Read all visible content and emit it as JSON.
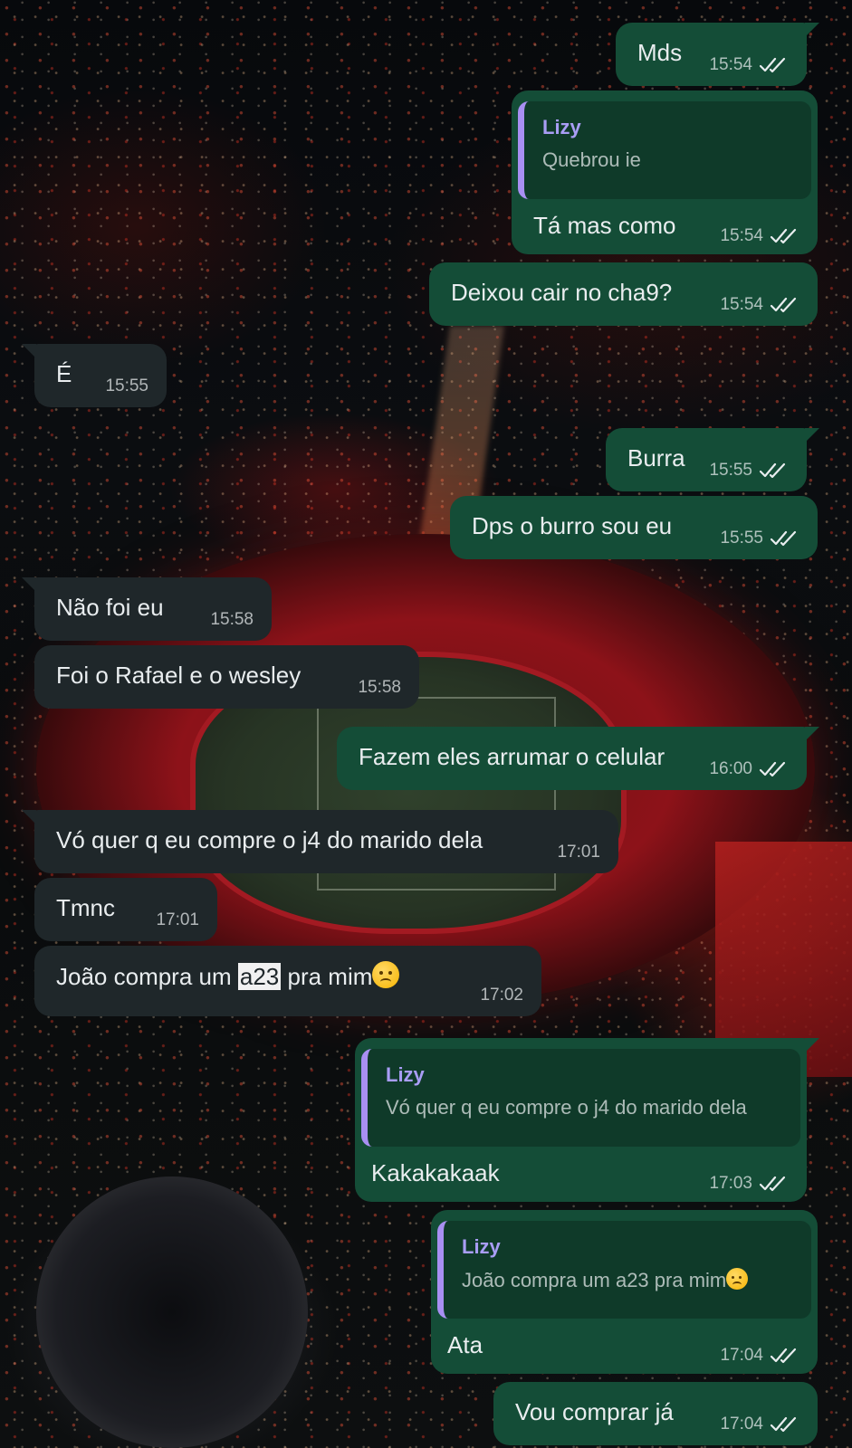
{
  "colors": {
    "outgoing_bubble": "#144d37",
    "incoming_bubble": "#1f272a",
    "quote_accent": "#a88ff2",
    "read_ticks": "#e9edef"
  },
  "messages": [
    {
      "id": "m1",
      "direction": "out",
      "text": "Mds",
      "time": "15:54",
      "status": "double-check"
    },
    {
      "id": "m2",
      "direction": "out",
      "quote": {
        "author": "Lizy",
        "text": "Quebrou ie"
      },
      "text": "Tá mas como",
      "time": "15:54",
      "status": "double-check"
    },
    {
      "id": "m3",
      "direction": "out",
      "text": "Deixou cair no cha9?",
      "time": "15:54",
      "status": "double-check"
    },
    {
      "id": "m4",
      "direction": "in",
      "text": "É",
      "time": "15:55"
    },
    {
      "id": "m5",
      "direction": "out",
      "text": "Burra",
      "time": "15:55",
      "status": "double-check"
    },
    {
      "id": "m6",
      "direction": "out",
      "text": "Dps o burro sou eu",
      "time": "15:55",
      "status": "double-check"
    },
    {
      "id": "m7",
      "direction": "in",
      "text": "Não foi eu",
      "time": "15:58"
    },
    {
      "id": "m8",
      "direction": "in",
      "text": "Foi o Rafael e o wesley",
      "time": "15:58"
    },
    {
      "id": "m9",
      "direction": "out",
      "text": "Fazem eles arrumar o celular",
      "time": "16:00",
      "status": "double-check"
    },
    {
      "id": "m10",
      "direction": "in",
      "text": "Vó quer q eu compre o j4 do marido dela",
      "time": "17:01"
    },
    {
      "id": "m11",
      "direction": "in",
      "text": "Tmnc",
      "time": "17:01"
    },
    {
      "id": "m12",
      "direction": "in",
      "text_before": "João compra um ",
      "text_highlight": "a23",
      "text_after": " pra mim",
      "emoji": "disappointed-face",
      "time": "17:02"
    },
    {
      "id": "m13",
      "direction": "out",
      "quote": {
        "author": "Lizy",
        "text": "Vó quer q eu compre o j4 do marido dela"
      },
      "text": "Kakakakaak",
      "time": "17:03",
      "status": "double-check"
    },
    {
      "id": "m14",
      "direction": "out",
      "quote": {
        "author": "Lizy",
        "text": "João compra um a23 pra mim",
        "emoji": "disappointed-face"
      },
      "text": "Ata",
      "time": "17:04",
      "status": "double-check"
    },
    {
      "id": "m15",
      "direction": "out",
      "text": "Vou comprar já",
      "time": "17:04",
      "status": "double-check"
    }
  ]
}
